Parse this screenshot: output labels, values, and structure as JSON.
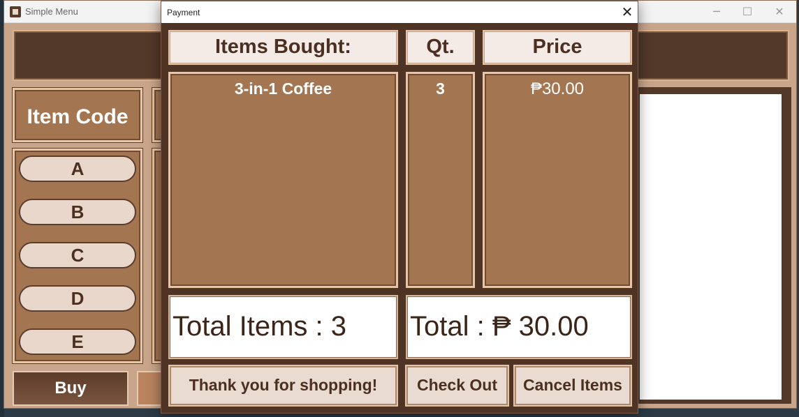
{
  "main_window": {
    "title": "Simple Menu",
    "controls": {
      "minimize": "─",
      "maximize": "☐",
      "close": "✕"
    },
    "item_code_label": "Item Code",
    "item_buttons": [
      "A",
      "B",
      "C",
      "D",
      "E"
    ],
    "buy_label": "Buy"
  },
  "dialog": {
    "title": "Payment",
    "close_glyph": "✕",
    "headers": {
      "items": "Items Bought:",
      "qty": "Qt.",
      "price": "Price"
    },
    "rows": [
      {
        "item": "3-in-1 Coffee",
        "qty": "3",
        "price": "₱30.00"
      }
    ],
    "total_items": "Total Items : 3",
    "total": "Total : ₱ 30.00",
    "buttons": {
      "thanks": "Thank you for shopping!",
      "checkout": "Check Out",
      "cancel": "Cancel Items"
    }
  },
  "colors": {
    "dark_brown": "#53392a",
    "panel_brown": "#a37551",
    "cream": "#f5ebe6",
    "border_tan": "#e9c6a3"
  }
}
